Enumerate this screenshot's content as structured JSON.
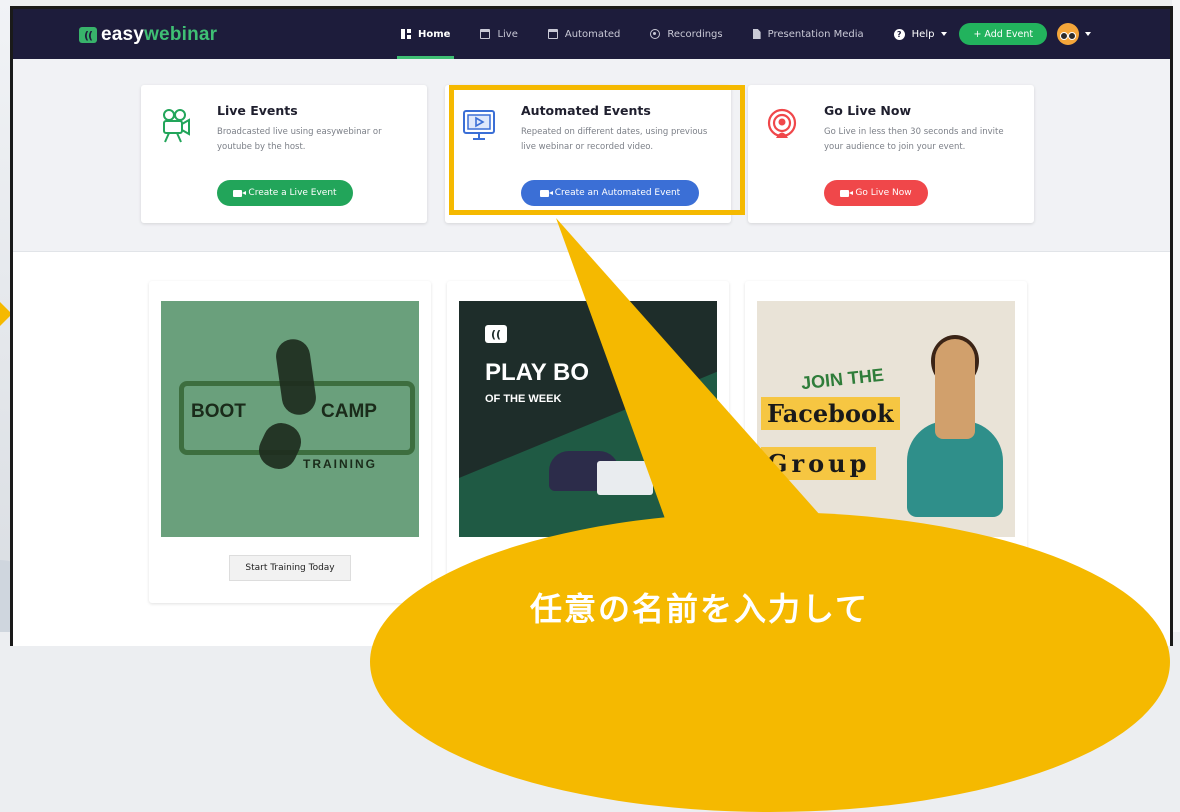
{
  "brand": {
    "logo_mark": "((",
    "name_part1": "easy",
    "name_part2": "webinar",
    "accent_color": "#3fbf74",
    "nav_bg": "#1d1c3b"
  },
  "nav": {
    "items": [
      {
        "label": "Home",
        "icon": "grid-icon",
        "active": true
      },
      {
        "label": "Live",
        "icon": "calendar-icon",
        "active": false
      },
      {
        "label": "Automated",
        "icon": "calendar-icon",
        "active": false
      },
      {
        "label": "Recordings",
        "icon": "record-icon",
        "active": false
      },
      {
        "label": "Presentation Media",
        "icon": "file-icon",
        "active": false
      }
    ],
    "help_label": "Help",
    "add_event_label": "+ Add Event"
  },
  "event_types": [
    {
      "title": "Live Events",
      "description": "Broadcasted live using easywebinar or youtube by the host.",
      "button": "Create a Live Event",
      "button_color": "#22a55a",
      "icon": "film-camera-icon"
    },
    {
      "title": "Automated Events",
      "description": "Repeated on different dates, using previous live webinar or recorded video.",
      "button": "Create an Automated Event",
      "button_color": "#3b6fd6",
      "icon": "monitor-play-icon"
    },
    {
      "title": "Go Live Now",
      "description": "Go Live in less then 30 seconds and invite your audience to join your event.",
      "button": "Go Live Now",
      "button_color": "#f0474a",
      "icon": "broadcast-icon"
    }
  ],
  "promos": [
    {
      "words": [
        "BOOT",
        "CAMP",
        "TRAINING"
      ],
      "button": "Start Training Today"
    },
    {
      "logo_mark": "((",
      "headline": "PLAY BO",
      "subline": "OF THE WEEK"
    },
    {
      "line1": "JOIN THE",
      "line2": "Facebook",
      "line3": "Group"
    }
  ],
  "callout": {
    "text": "任意の名前を入力して",
    "color": "#f5b900"
  }
}
